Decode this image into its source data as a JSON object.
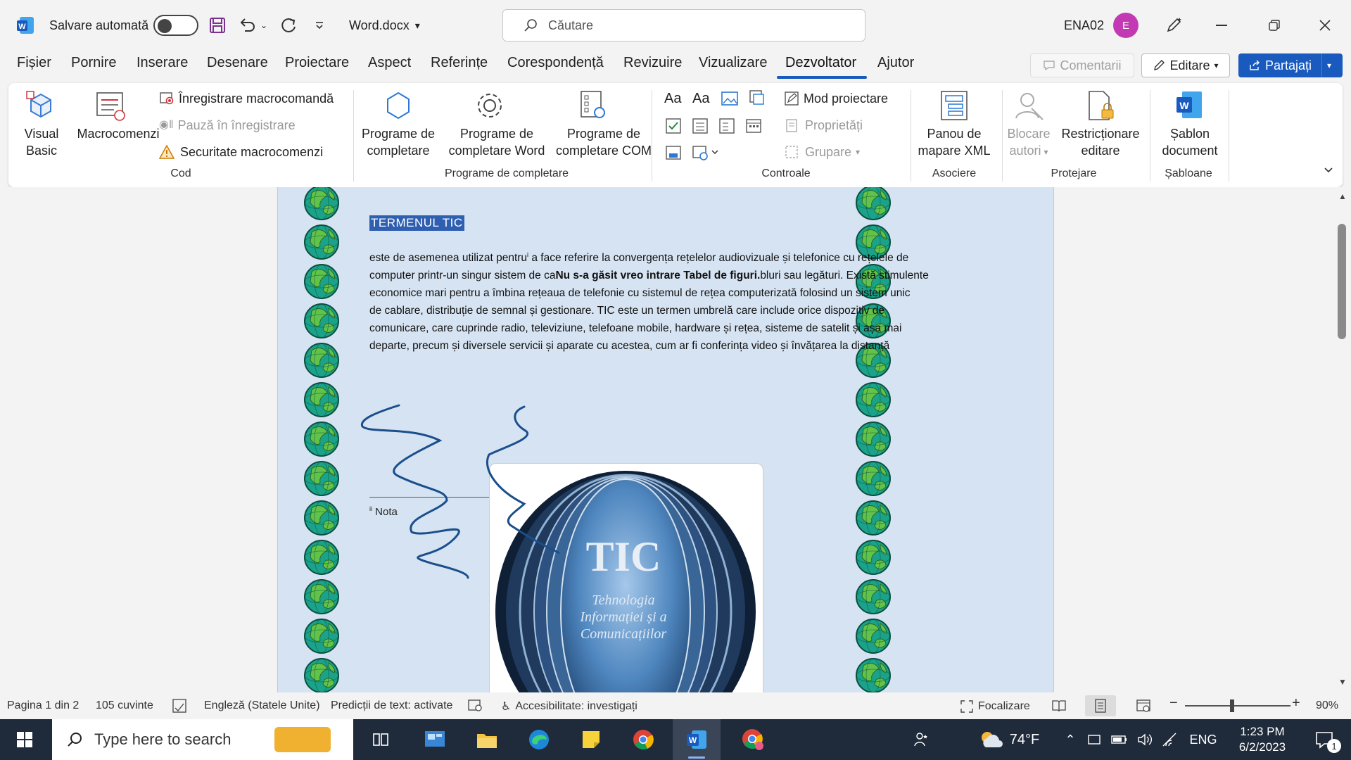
{
  "titlebar": {
    "autosave_label": "Salvare automată",
    "filename": "Word.docx",
    "search_placeholder": "Căutare",
    "user_name": "ENA02",
    "avatar_initial": "E"
  },
  "menu": {
    "tabs": [
      "Fișier",
      "Pornire",
      "Inserare",
      "Desenare",
      "Proiectare",
      "Aspect",
      "Referințe",
      "Corespondență",
      "Revizuire",
      "Vizualizare",
      "Dezvoltator",
      "Ajutor"
    ],
    "active_tab": "Dezvoltator",
    "comments_label": "Comentarii",
    "editing_label": "Editare",
    "share_label": "Partajați"
  },
  "ribbon": {
    "code": {
      "visual_basic": [
        "Visual",
        "Basic"
      ],
      "macros": "Macrocomenzi",
      "record_macro": "Înregistrare macrocomandă",
      "pause_recording": "Pauză în înregistrare",
      "macro_security": "Securitate macrocomenzi",
      "group_label": "Cod"
    },
    "addins": {
      "addins": [
        "Programe de",
        "completare"
      ],
      "word_addins": [
        "Programe de",
        "completare Word"
      ],
      "com_addins": [
        "Programe de",
        "completare COM"
      ],
      "group_label": "Programe de completare"
    },
    "controls": {
      "design_mode": "Mod proiectare",
      "properties": "Proprietăți",
      "group": "Grupare",
      "group_label": "Controale"
    },
    "mapping": {
      "xml_pane": [
        "Panou de",
        "mapare XML"
      ],
      "group_label": "Asociere"
    },
    "protect": {
      "block_authors": [
        "Blocare",
        "autori"
      ],
      "restrict_editing": [
        "Restricționare",
        "editare"
      ],
      "group_label": "Protejare"
    },
    "templates": {
      "doc_template": [
        "Șablon",
        "document"
      ],
      "group_label": "Șabloane"
    }
  },
  "document": {
    "heading": "TERMENUL TIC",
    "para_line1": "este de asemenea utilizat pentru",
    "para_sup": "i",
    "para_line1b": " a face referire la convergența rețelelor audiovizuale și telefonice cu rețelele de",
    "para_line2a": "computer printr-un singur sistem de ca",
    "para_line2bold": "Nu s-a găsit vreo intrare Tabel de figuri.",
    "para_line2c": "bluri sau legături. Există stimulente",
    "para_line3": "economice mari pentru a îmbina rețeaua de telefonie cu sistemul de rețea computerizată folosind un sistem unic",
    "para_line4": "de cablare, distribuție de semnal și gestionare. TIC este un termen umbrelă care include orice dispozitiv de",
    "para_line5": "comunicare, care cuprinde radio, televiziune, telefoane mobile, hardware și rețea, sisteme de satelit și așa mai",
    "para_line6": "departe, precum și diversele servicii și aparate cu acestea, cum ar fi conferința video și învățarea la distanță",
    "footnote_mark": "ii",
    "footnote_text": "Nota",
    "image_title": "TIC",
    "image_sub1": "Tehnologia",
    "image_sub2": "Informației și a",
    "image_sub3": "Comunicațiilor"
  },
  "statusbar": {
    "page": "Pagina 1 din 2",
    "words": "105 cuvinte",
    "language": "Engleză (Statele Unite)",
    "predictions": "Predicții de text: activate",
    "accessibility": "Accesibilitate: investigați",
    "focus": "Focalizare",
    "zoom": "90%"
  },
  "taskbar": {
    "search_placeholder": "Type here to search",
    "weather": "74°F",
    "lang": "ENG",
    "time": "1:23 PM",
    "date": "6/2/2023",
    "notif_count": "1"
  }
}
